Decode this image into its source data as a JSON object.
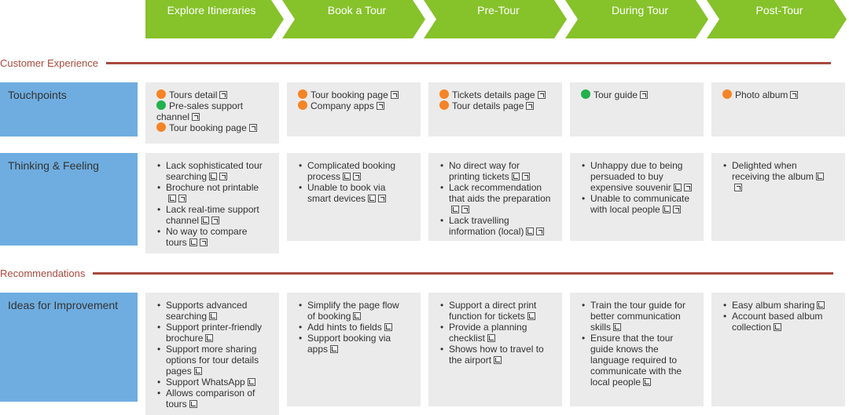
{
  "colors": {
    "phase_green": "#86c22a",
    "row_label_blue": "#6fade0",
    "section_red": "#a84a3e",
    "cell_gray": "#ebebeb",
    "dot_orange": "#f58426",
    "dot_green": "#22b14c"
  },
  "phases": [
    "Explore Itineraries",
    "Book a Tour",
    "Pre-Tour",
    "During Tour",
    "Post-Tour"
  ],
  "sections": {
    "customer_experience": "Customer Experience",
    "recommendations": "Recommendations"
  },
  "rows": {
    "touchpoints": {
      "label": "Touchpoints",
      "cells": [
        [
          {
            "text": "Tours detail",
            "dot": "orange"
          },
          {
            "text": "Pre-sales support channel",
            "dot": "green"
          },
          {
            "text": "Tour booking page",
            "dot": "orange"
          }
        ],
        [
          {
            "text": "Tour booking page",
            "dot": "orange"
          },
          {
            "text": "Company apps",
            "dot": "orange"
          }
        ],
        [
          {
            "text": "Tickets details page",
            "dot": "orange"
          },
          {
            "text": "Tour details page",
            "dot": "orange"
          }
        ],
        [
          {
            "text": "Tour guide",
            "dot": "green"
          }
        ],
        [
          {
            "text": "Photo album",
            "dot": "orange"
          }
        ]
      ]
    },
    "thinking_feeling": {
      "label": "Thinking & Feeling",
      "cells": [
        [
          "Lack sophisticated tour searching",
          "Brochure not printable",
          "Lack real-time support channel",
          "No way to compare tours"
        ],
        [
          "Complicated booking process",
          "Unable to book via smart devices"
        ],
        [
          "No direct way for printing tickets",
          "Lack recommendation that aids the preparation",
          "Lack travelling information (local)"
        ],
        [
          "Unhappy due to being persuaded to buy expensive souvenir",
          "Unable to communicate with local people"
        ],
        [
          "Delighted when receiving the album"
        ]
      ]
    },
    "ideas": {
      "label": "Ideas for Improvement",
      "cells": [
        [
          "Supports advanced searching",
          "Support printer-friendly brochure",
          "Support more sharing options for tour details pages",
          "Support WhatsApp",
          "Allows comparison of tours"
        ],
        [
          "Simplify the page flow of booking",
          "Add hints to fields",
          "Support booking via apps"
        ],
        [
          "Support a direct print function for tickets",
          "Provide a planning checklist",
          "Shows how to travel to the airport"
        ],
        [
          "Train the tour guide for better communication skills",
          "Ensure that the tour guide knows the language required to communicate with the local people"
        ],
        [
          "Easy album sharing",
          "Account based album collection"
        ]
      ]
    }
  }
}
